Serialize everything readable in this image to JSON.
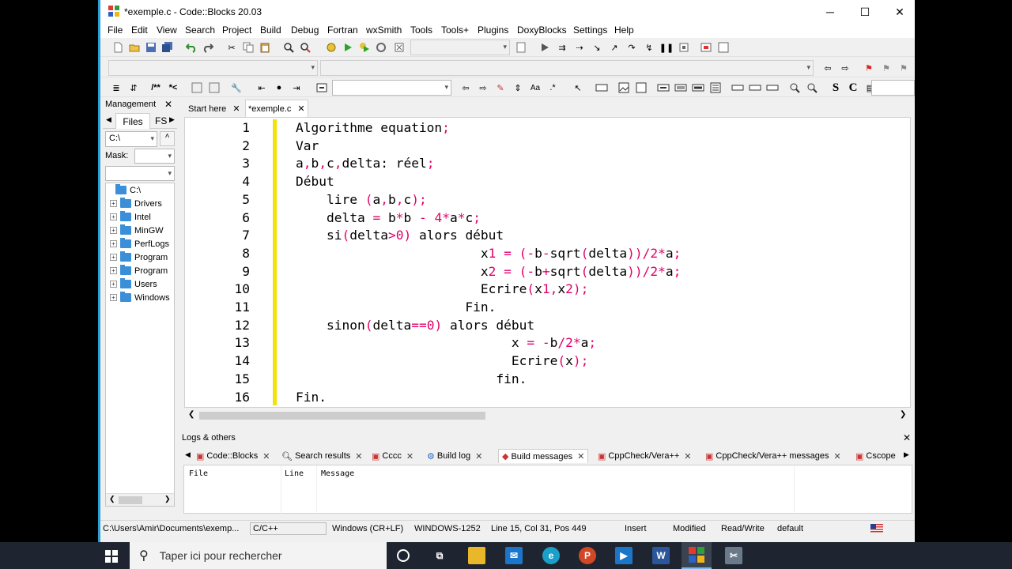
{
  "window": {
    "title": "*exemple.c - Code::Blocks 20.03",
    "minimize": "─",
    "maximize": "☐",
    "close": "✕"
  },
  "menu": [
    "File",
    "Edit",
    "View",
    "Search",
    "Project",
    "Build",
    "Debug",
    "Fortran",
    "wxSmith",
    "Tools",
    "Tools+",
    "Plugins",
    "DoxyBlocks",
    "Settings",
    "Help"
  ],
  "toolbar3": {
    "bold_s": "S",
    "bold_c": "C",
    "comment": "/**",
    "comment2": "*<"
  },
  "management": {
    "title": "Management",
    "close": "✕",
    "tab_files": "Files",
    "tab_fs": "FS",
    "drive": "C:\\",
    "mask_label": "Mask:",
    "tree_root": "C:\\",
    "tree": [
      "Drivers",
      "Intel",
      "MinGW",
      "PerfLogs",
      "Program",
      "Program",
      "Users",
      "Windows"
    ]
  },
  "editor": {
    "tabs": [
      {
        "label": "Start here"
      },
      {
        "label": "*exemple.c"
      }
    ],
    "lines": [
      {
        "n": "1",
        "t": "Algorithme equation;"
      },
      {
        "n": "2",
        "t": "Var"
      },
      {
        "n": "3",
        "t": "a,b,c,delta: réel;"
      },
      {
        "n": "4",
        "t": "Début"
      },
      {
        "n": "5",
        "t": "    lire (a,b,c);"
      },
      {
        "n": "6",
        "t": "    delta = b*b - 4*a*c;"
      },
      {
        "n": "7",
        "t": "    si(delta>0) alors début"
      },
      {
        "n": "8",
        "t": "                        x1 = (-b-sqrt(delta))/2*a;"
      },
      {
        "n": "9",
        "t": "                        x2 = (-b+sqrt(delta))/2*a;"
      },
      {
        "n": "10",
        "t": "                        Ecrire(x1,x2);"
      },
      {
        "n": "11",
        "t": "                      Fin."
      },
      {
        "n": "12",
        "t": "    sinon(delta==0) alors début"
      },
      {
        "n": "13",
        "t": "                            x = -b/2*a;"
      },
      {
        "n": "14",
        "t": "                            Ecrire(x);"
      },
      {
        "n": "15",
        "t": "                          fin."
      },
      {
        "n": "16",
        "t": "Fin."
      }
    ]
  },
  "logs": {
    "title": "Logs & others",
    "close": "✕",
    "tabs": [
      "Code::Blocks",
      "Search results",
      "Cccc",
      "Build log",
      "Build messages",
      "CppCheck/Vera++",
      "CppCheck/Vera++ messages",
      "Cscope"
    ],
    "columns": [
      "File",
      "Line",
      "Message"
    ]
  },
  "status": {
    "path": "C:\\Users\\Amir\\Documents\\exemp...",
    "lang": "C/C++",
    "eol": "Windows (CR+LF)",
    "enc": "WINDOWS-1252",
    "pos": "Line 15, Col 31, Pos 449",
    "mode": "Insert",
    "modified": "Modified",
    "rw": "Read/Write",
    "profile": "default"
  },
  "taskbar": {
    "search_placeholder": "Taper ici pour rechercher"
  }
}
